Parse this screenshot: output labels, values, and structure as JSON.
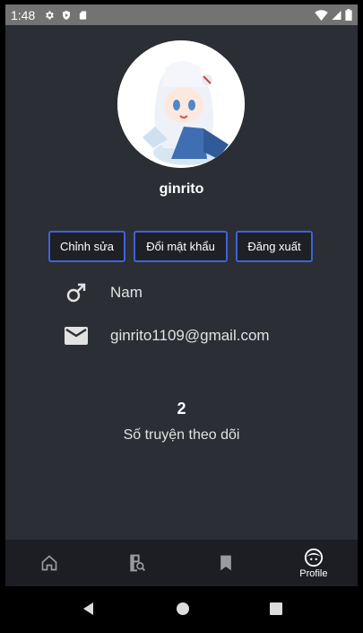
{
  "status_bar": {
    "time": "1:48",
    "left_icons": [
      "gear-icon",
      "play-protect-icon",
      "sd-card-icon"
    ],
    "right_icons": [
      "wifi-icon",
      "signal-icon",
      "battery-icon"
    ]
  },
  "profile": {
    "username": "ginrito",
    "buttons": {
      "edit": "Chỉnh sửa",
      "change_password": "Đổi mật khẩu",
      "logout": "Đăng xuất"
    },
    "gender": "Nam",
    "email": "ginrito1109@gmail.com",
    "followed_count": "2",
    "followed_label": "Số truyện theo dõi"
  },
  "bottom_nav": {
    "items": [
      {
        "icon": "home-icon",
        "label": ""
      },
      {
        "icon": "search-book-icon",
        "label": ""
      },
      {
        "icon": "bookmark-icon",
        "label": ""
      },
      {
        "icon": "profile-icon",
        "label": "Profile"
      }
    ],
    "active_index": 3
  },
  "system_nav": {
    "icons": [
      "back-icon",
      "home-circle-icon",
      "recents-icon"
    ]
  },
  "colors": {
    "background": "#2c2e35",
    "button_border": "#3d63d6",
    "bottom_nav": "#1d1e24",
    "status_bar": "#737373"
  }
}
